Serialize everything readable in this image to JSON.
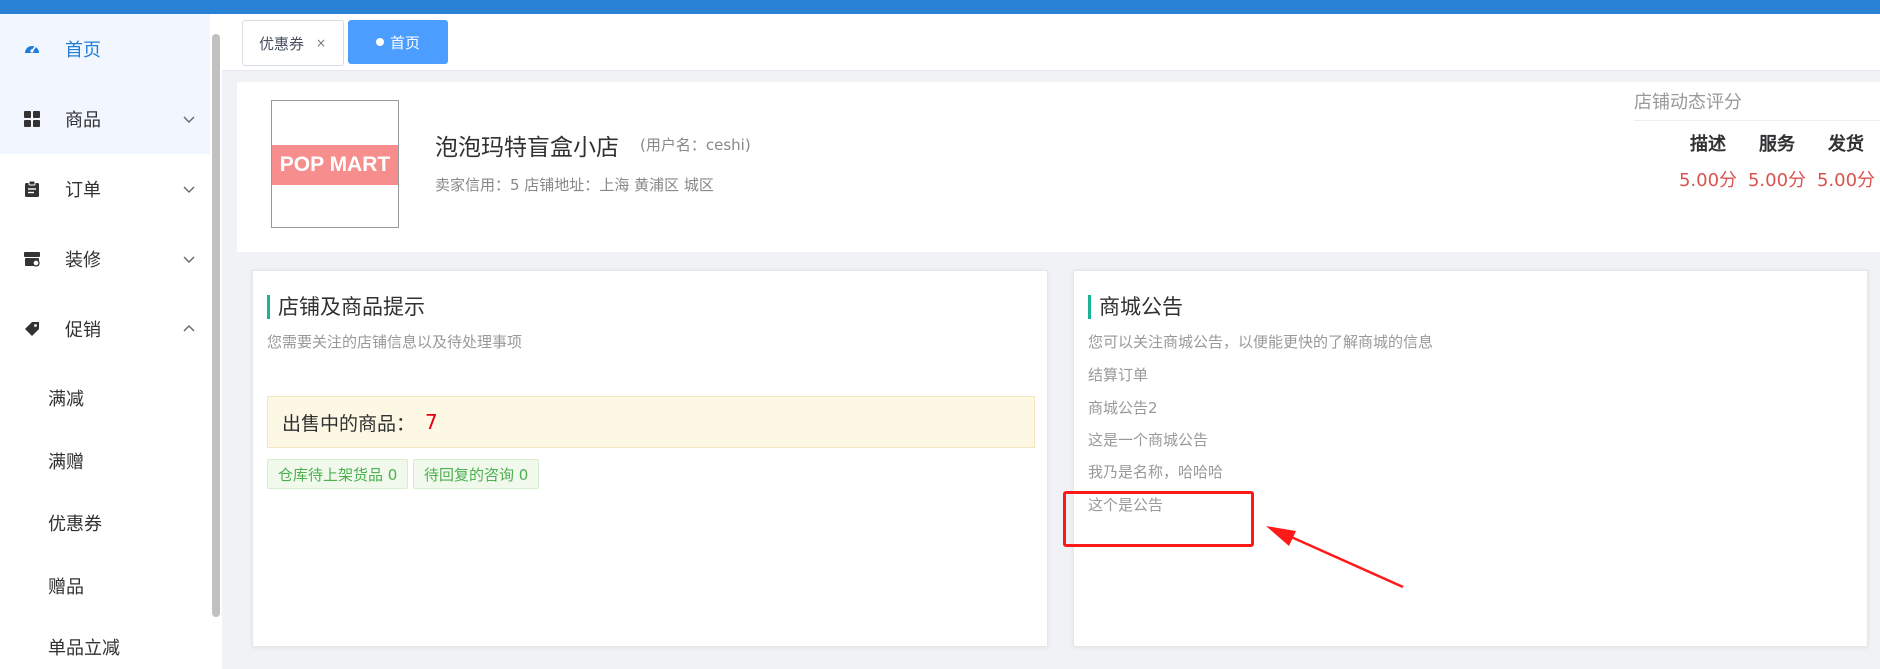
{
  "sidebar": {
    "items": [
      {
        "label": "首页",
        "icon": "dashboard-icon"
      },
      {
        "label": "商品",
        "icon": "grid-icon"
      },
      {
        "label": "订单",
        "icon": "clipboard-icon"
      },
      {
        "label": "装修",
        "icon": "store-icon"
      },
      {
        "label": "促销",
        "icon": "tag-icon"
      }
    ],
    "promo_sub": [
      "满减",
      "满赠",
      "优惠券",
      "赠品",
      "单品立减"
    ]
  },
  "tabs": {
    "coupon": "优惠券",
    "home": "首页",
    "close": "×"
  },
  "shop": {
    "logo_text": "POP MART",
    "name": "泡泡玛特盲盒小店",
    "username": "(用户名：ceshi)",
    "meta": "卖家信用：5   店铺地址：上海 黄浦区 城区"
  },
  "ratings": {
    "title": "店铺动态评分",
    "columns": [
      {
        "label": "描述",
        "value": "5.00分"
      },
      {
        "label": "服务",
        "value": "5.00分"
      },
      {
        "label": "发货",
        "value": "5.00分"
      }
    ]
  },
  "tips": {
    "title": "店铺及商品提示",
    "subtitle": "您需要关注的店铺信息以及待处理事项",
    "selling_label": "出售中的商品：",
    "selling_value": "7",
    "badges": [
      "仓库待上架货品 0",
      "待回复的咨询 0"
    ]
  },
  "notices": {
    "title": "商城公告",
    "subtitle": "您可以关注商城公告，以便能更快的了解商城的信息",
    "items": [
      "结算订单",
      "商城公告2",
      "这是一个商城公告",
      "我乃是名称，哈哈哈",
      "这个是公告"
    ]
  },
  "colors": {
    "accent": "#2a82d6",
    "tab_active": "#4b9eff",
    "title_bar": "#1ab394",
    "score": "#d9534f",
    "highlight": "#ff1a1a"
  }
}
